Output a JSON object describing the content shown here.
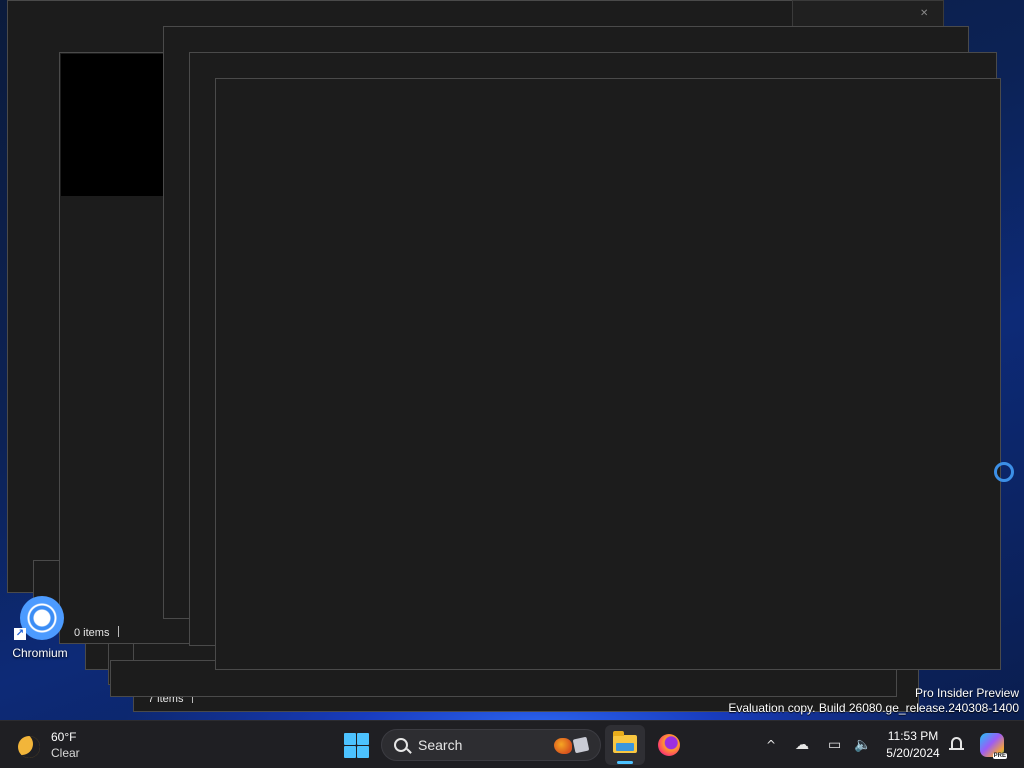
{
  "desktop": {
    "icon_label": "Chromium",
    "watermark_line1": "Pro Insider Preview",
    "watermark_line2": "Evaluation copy. Build 26080.ge_release.240308-1400"
  },
  "windows": {
    "explorer_a_status": "0 items",
    "explorer_b_status": "7 items"
  },
  "taskbar": {
    "weather_temp": "60°F",
    "weather_condition": "Clear",
    "search_placeholder": "Search",
    "time": "11:53 PM",
    "date": "5/20/2024",
    "copilot_badge": "PRE",
    "tray_chevron": "^"
  },
  "colors": {
    "accent": "#4cc2ff",
    "window_bg": "#1c1c1c",
    "taskbar_bg": "#1f1f23"
  }
}
